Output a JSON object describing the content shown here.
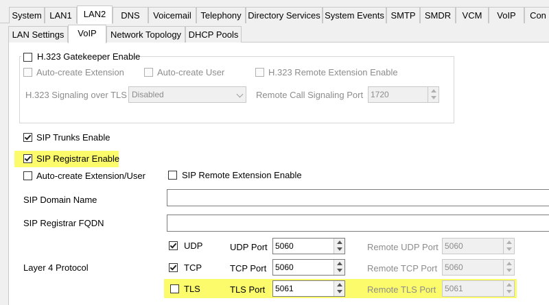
{
  "tabs_main": [
    "System",
    "LAN1",
    "LAN2",
    "DNS",
    "Voicemail",
    "Telephony",
    "Directory Services",
    "System Events",
    "SMTP",
    "SMDR",
    "VCM",
    "VoIP",
    "Con"
  ],
  "tabs_sub": [
    "LAN Settings",
    "VoIP",
    "Network Topology",
    "DHCP Pools"
  ],
  "h323": {
    "gatekeeper_label": "H.323 Gatekeeper Enable",
    "auto_ext_label": "Auto-create Extension",
    "auto_user_label": "Auto-create User",
    "remote_ext_label": "H.323 Remote Extension Enable",
    "tls_label": "H.323 Signaling over TLS",
    "tls_value": "Disabled",
    "remote_port_label": "Remote Call Signaling Port",
    "remote_port_value": "1720"
  },
  "sip": {
    "trunks_label": "SIP Trunks Enable",
    "registrar_label": "SIP Registrar Enable",
    "auto_create_label": "Auto-create Extension/User",
    "remote_ext_label": "SIP Remote Extension Enable",
    "domain_label": "SIP Domain Name",
    "domain_value": "",
    "fqdn_label": "SIP Registrar FQDN",
    "fqdn_value": "",
    "layer4_label": "Layer 4 Protocol",
    "protocols": [
      {
        "name": "UDP",
        "port_label": "UDP Port",
        "port": "5060",
        "remote_label": "Remote UDP Port",
        "remote_port": "5060"
      },
      {
        "name": "TCP",
        "port_label": "TCP Port",
        "port": "5060",
        "remote_label": "Remote TCP Port",
        "remote_port": "5060"
      },
      {
        "name": "TLS",
        "port_label": "TLS Port",
        "port": "5061",
        "remote_label": "Remote TLS Port",
        "remote_port": "5061"
      }
    ]
  },
  "colors": {
    "highlight": "#fbfb6c",
    "panel": "#ffffff",
    "background": "#f0f0f0"
  }
}
